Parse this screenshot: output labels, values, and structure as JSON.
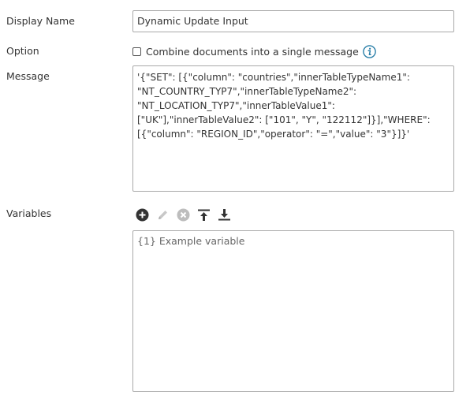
{
  "fields": {
    "display_name": {
      "label": "Display Name",
      "value": "Dynamic Update Input"
    },
    "option": {
      "label": "Option",
      "checkbox_label": "Combine documents into a single message",
      "checked": false
    },
    "message": {
      "label": "Message",
      "value": "'{\"SET\": [{\"column\": \"countries\",\"innerTableTypeName1\":\n\"NT_COUNTRY_TYP7\",\"innerTableTypeName2\":\n\"NT_LOCATION_TYP7\",\"innerTableValue1\":\n[\"UK\"],\"innerTableValue2\": [\"101\", \"Y\", \"122112\"]}],\"WHERE\":\n[{\"column\": \"REGION_ID\",\"operator\": \"=\",\"value\": \"3\"}]}'"
    },
    "variables": {
      "label": "Variables",
      "items": [
        "{1} Example variable"
      ]
    }
  },
  "toolbar": {
    "icons": [
      "add-icon",
      "edit-icon",
      "remove-icon",
      "move-to-top-icon",
      "move-to-bottom-icon"
    ]
  },
  "colors": {
    "accent": "#2a7fa8",
    "icon_dark": "#333333",
    "icon_disabled": "#bdbdbd",
    "border": "#a9a9a9"
  }
}
